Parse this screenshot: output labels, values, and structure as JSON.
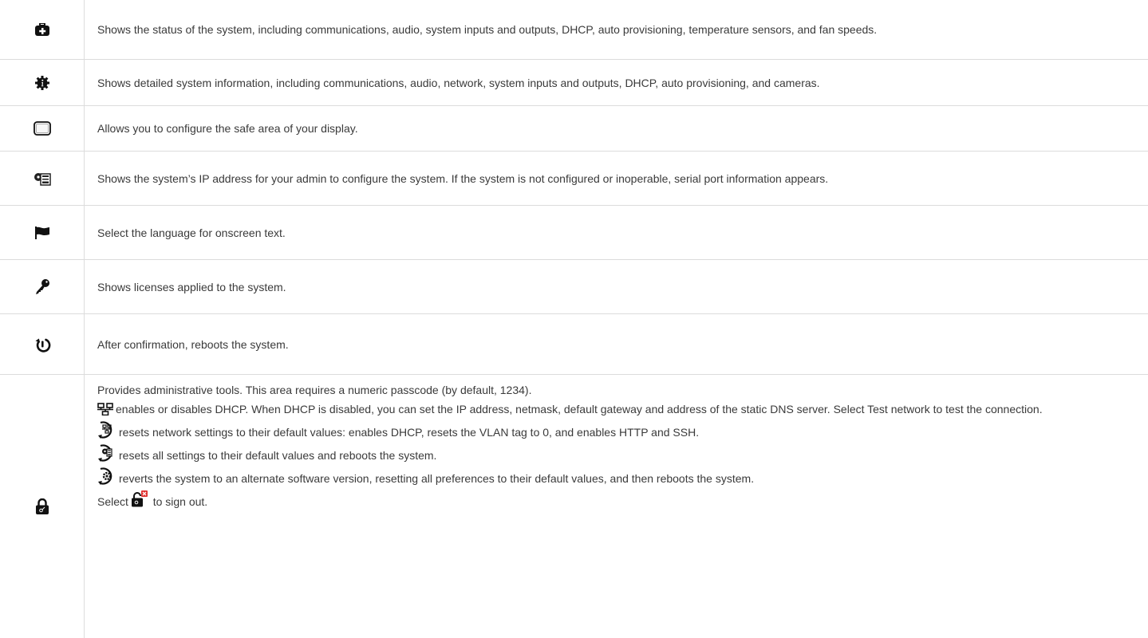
{
  "rows": [
    {
      "icon": "first-aid-kit-icon",
      "text": "Shows the status of the system, including communications, audio, system inputs and outputs, DHCP, auto provisioning, temperature sensors, and fan speeds."
    },
    {
      "icon": "info-gear-icon",
      "text": "Shows detailed system information, including communications, audio, network, system inputs and outputs, DHCP, auto provisioning, and cameras."
    },
    {
      "icon": "display-icon",
      "text": "Allows you to configure the safe area of your display."
    },
    {
      "icon": "system-ip-icon",
      "text": "Shows the system’s IP address for your admin to configure the system. If the system is not configured or inoperable, serial port information appears."
    },
    {
      "icon": "flag-icon",
      "text": "Select the language for onscreen text."
    },
    {
      "icon": "key-icon",
      "text": "Shows licenses applied to the system."
    },
    {
      "icon": "reboot-icon",
      "text": "After confirmation, reboots the system."
    }
  ],
  "admin": {
    "icon": "lock-icon",
    "intro": "Provides administrative tools. This area requires a numeric passcode (by default, 1234).",
    "dhcp": "enables or disables DHCP. When DHCP is disabled, you can set the IP address, netmask, default gateway and address of the static DNS server. Select Test network to test the connection.",
    "network_reset": "resets network settings to their default values: enables DHCP, resets the VLAN tag to 0, and enables HTTP and SSH.",
    "factory_reset": "resets all settings to their default values and reboots the system.",
    "revert": "reverts the system to an alternate software version, resetting all preferences to their default values, and then reboots the system.",
    "signout_before": "Select",
    "signout_after": "to sign out."
  }
}
